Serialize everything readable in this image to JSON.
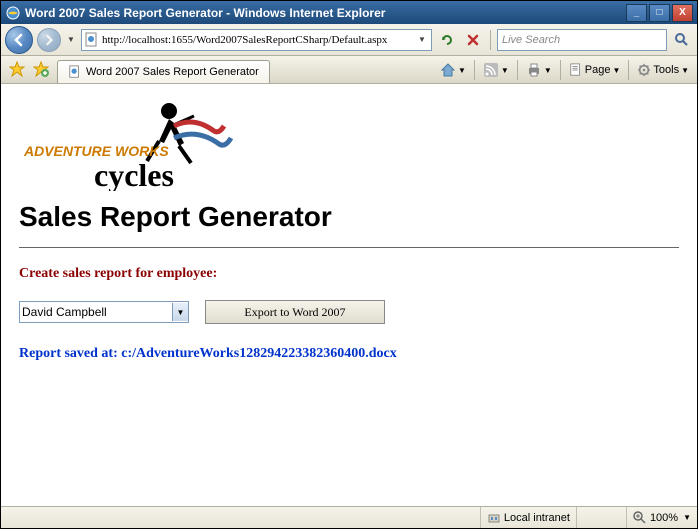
{
  "window": {
    "title": "Word 2007 Sales Report Generator - Windows Internet Explorer",
    "minimize": "_",
    "maximize": "□",
    "close": "X"
  },
  "navbar": {
    "url": "http://localhost:1655/Word2007SalesReportCSharp/Default.aspx",
    "search_placeholder": "Live Search"
  },
  "tab": {
    "label": "Word 2007 Sales Report Generator"
  },
  "toolbar": {
    "page": "Page",
    "tools": "Tools"
  },
  "page": {
    "logo_text_top": "ADVENTURE WORKS",
    "logo_text_bottom": "cycles",
    "heading": "Sales Report Generator",
    "prompt": "Create sales report for employee:",
    "selected_employee": "David Campbell",
    "export_button": "Export to Word 2007",
    "status_message": "Report saved at: c:/AdventureWorks128294223382360400.docx"
  },
  "statusbar": {
    "zone": "Local intranet",
    "zoom": "100%"
  }
}
